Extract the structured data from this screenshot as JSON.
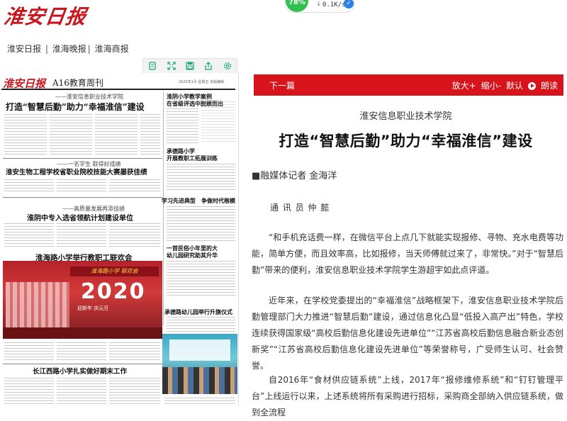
{
  "masthead": {
    "logo": "淮安日报"
  },
  "speed_widget": {
    "percent": "78%",
    "speed": "0.1K/s"
  },
  "pub_links": [
    "淮安日报",
    "淮海晚报",
    "淮海商报"
  ],
  "toolbar_icons": [
    "page-icon",
    "expand-icon",
    "save-icon",
    "share-icon",
    "settings-icon"
  ],
  "newspaper": {
    "logo": "淮安日报",
    "section": "A16教育周刊",
    "date": "2020年1月 星期五 本版编辑",
    "kicker1": "——淮安信息职业技术学院",
    "headline1": "打造“智慧后勤”助力“幸福淮信”建设",
    "side_head1": "淮阴小学教学案例\n在省级评选中脱颖而出",
    "side_head2": "承德路小学\n开展教职工拓展训练",
    "kicker2": "——一名学生 取得好成绩",
    "headline2": "淮安生物工程学校省职业院校技能大赛屡获佳绩",
    "side_head3": "学习先进典型　争做时代楷模",
    "kicker3": "——高质量发展再添佳绩",
    "headline3": "淮阴中专入选省领航计划建设单位",
    "side_head4": "一首民俗小年里的大\n幼儿园研究助其升华",
    "headline4": "淮海路小学举行教职工联欢会",
    "photo_banner": "淮海路小学 联欢会",
    "photo_year": "2020",
    "photo_sub": "迎新年 庆元旦",
    "side_head5": "承德路幼儿园举行升旗仪式",
    "headline5": "长江西路小学扎实做好期末工作"
  },
  "reader": {
    "next_label": "下一篇",
    "tools": [
      "放大+",
      "缩小-",
      "默认",
      "朗读"
    ],
    "subtitle": "淮安信息职业技术学院",
    "title": "打造“智慧后勤”助力“幸福淮信”建设",
    "byline": "■融媒体记者 金海洋",
    "correspondent": "通 讯 员 仲 懿",
    "paragraphs": [
      "“和手机充话费一样，在微信平台上点几下就能实现报修、寻物、充水电费等功能，简单方便，而且效率高，比如报修，当天师傅就过来了，非常快。”对于“智慧后勤”带来的便利，淮安信息职业技术学院学生游超宇如此点评道。",
      "近年来，在学校党委提出的“幸福淮信”战略框架下，淮安信息职业技术学院后勤管理部门大力推进“智慧后勤”建设，通过信息化凸显“低投入高产出”特色，学校连续获得国家级“高校后勤信息化建设先进单位”“江苏省高校后勤信息融合新业态创新奖”“江苏省高校后勤信息化建设先进单位”等荣誉称号，广受师生认可、社会赞誉。",
      "自2016年“食材供应链系统”上线，2017年“报修维修系统”和“钉钉管理平台”上线运行以来，上述系统将所有采购进行招标，采购商全部纳入供应链系统，做到全流程"
    ]
  },
  "colors": {
    "brand_red": "#c8161d",
    "bar_red": "#d7141c",
    "toolbar_green": "#1aa87a"
  }
}
